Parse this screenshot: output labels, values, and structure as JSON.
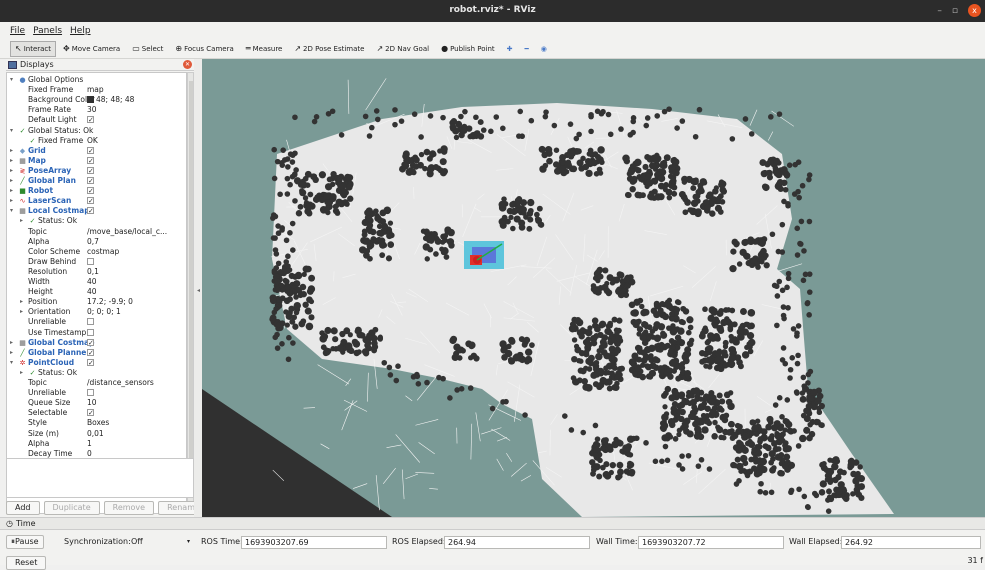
{
  "window": {
    "title": "robot.rviz* - RViz",
    "minimize": "–",
    "maximize": "▫",
    "close": "x"
  },
  "menu": [
    "File",
    "Panels",
    "Help"
  ],
  "toolbar": {
    "tools": [
      {
        "label": "Interact",
        "icon": "cursor-icon",
        "glyph": "↖",
        "active": true
      },
      {
        "label": "Move Camera",
        "icon": "move-camera-icon",
        "glyph": "✥",
        "active": false
      },
      {
        "label": "Select",
        "icon": "select-icon",
        "glyph": "▭",
        "active": false
      },
      {
        "label": "Focus Camera",
        "icon": "focus-camera-icon",
        "glyph": "⊕",
        "active": false
      },
      {
        "label": "Measure",
        "icon": "measure-icon",
        "glyph": "═",
        "active": false
      },
      {
        "label": "2D Pose Estimate",
        "icon": "pose-estimate-icon",
        "glyph": "↗",
        "active": false
      },
      {
        "label": "2D Nav Goal",
        "icon": "nav-goal-icon",
        "glyph": "↗",
        "active": false
      },
      {
        "label": "Publish Point",
        "icon": "publish-point-icon",
        "glyph": "●",
        "active": false
      }
    ],
    "extra": [
      "✚",
      "━",
      "◉"
    ]
  },
  "displays_panel": {
    "title": "Displays",
    "rows": [
      {
        "indent": 0,
        "expand": "▾",
        "icon": "●",
        "icon_color": "#4f7fbf",
        "label": "Global Options",
        "value": "",
        "check": null,
        "blue": false
      },
      {
        "indent": 1,
        "expand": "",
        "icon": "",
        "label": "Fixed Frame",
        "value": "map",
        "check": null
      },
      {
        "indent": 1,
        "expand": "",
        "icon": "",
        "label": "Background Color",
        "value": "48; 48; 48",
        "swatch": "#303030",
        "check": null
      },
      {
        "indent": 1,
        "expand": "",
        "icon": "",
        "label": "Frame Rate",
        "value": "30",
        "check": null
      },
      {
        "indent": 1,
        "expand": "",
        "icon": "",
        "label": "Default Light",
        "value": "",
        "check": true
      },
      {
        "indent": 0,
        "expand": "▾",
        "icon": "✓",
        "icon_color": "#2e8b2e",
        "label": "Global Status: Ok",
        "value": "",
        "check": null
      },
      {
        "indent": 1,
        "expand": "",
        "icon": "✓",
        "icon_color": "#2e8b2e",
        "label": "Fixed Frame",
        "value": "OK",
        "check": null
      },
      {
        "indent": 0,
        "expand": "▸",
        "icon": "◆",
        "icon_color": "#7aa0c8",
        "label": "Grid",
        "value": "",
        "check": true,
        "blue": true
      },
      {
        "indent": 0,
        "expand": "▸",
        "icon": "▦",
        "icon_color": "#666",
        "label": "Map",
        "value": "",
        "check": true,
        "blue": true
      },
      {
        "indent": 0,
        "expand": "▸",
        "icon": "≷",
        "icon_color": "#d03030",
        "label": "PoseArray",
        "value": "",
        "check": true,
        "blue": true
      },
      {
        "indent": 0,
        "expand": "▸",
        "icon": "╱",
        "icon_color": "#2e8b2e",
        "label": "Global Plan",
        "value": "",
        "check": true,
        "blue": true
      },
      {
        "indent": 0,
        "expand": "▸",
        "icon": "■",
        "icon_color": "#2e8b2e",
        "label": "Robot",
        "value": "",
        "check": true,
        "blue": true
      },
      {
        "indent": 0,
        "expand": "▸",
        "icon": "∿",
        "icon_color": "#d03030",
        "label": "LaserScan",
        "value": "",
        "check": true,
        "blue": true
      },
      {
        "indent": 0,
        "expand": "▾",
        "icon": "▦",
        "icon_color": "#666",
        "label": "Local Costmap",
        "value": "",
        "check": true,
        "blue": true
      },
      {
        "indent": 1,
        "expand": "▸",
        "icon": "✓",
        "icon_color": "#2e8b2e",
        "label": "Status: Ok",
        "value": "",
        "check": null
      },
      {
        "indent": 1,
        "expand": "",
        "icon": "",
        "label": "Topic",
        "value": "/move_base/local_c...",
        "check": null
      },
      {
        "indent": 1,
        "expand": "",
        "icon": "",
        "label": "Alpha",
        "value": "0,7",
        "check": null
      },
      {
        "indent": 1,
        "expand": "",
        "icon": "",
        "label": "Color Scheme",
        "value": "costmap",
        "check": null
      },
      {
        "indent": 1,
        "expand": "",
        "icon": "",
        "label": "Draw Behind",
        "value": "",
        "check": false
      },
      {
        "indent": 1,
        "expand": "",
        "icon": "",
        "label": "Resolution",
        "value": "0,1",
        "check": null
      },
      {
        "indent": 1,
        "expand": "",
        "icon": "",
        "label": "Width",
        "value": "40",
        "check": null
      },
      {
        "indent": 1,
        "expand": "",
        "icon": "",
        "label": "Height",
        "value": "40",
        "check": null
      },
      {
        "indent": 1,
        "expand": "▸",
        "icon": "",
        "label": "Position",
        "value": "17.2; -9.9; 0",
        "check": null
      },
      {
        "indent": 1,
        "expand": "▸",
        "icon": "",
        "label": "Orientation",
        "value": "0; 0; 0; 1",
        "check": null
      },
      {
        "indent": 1,
        "expand": "",
        "icon": "",
        "label": "Unreliable",
        "value": "",
        "check": false
      },
      {
        "indent": 1,
        "expand": "",
        "icon": "",
        "label": "Use Timestamp",
        "value": "",
        "check": false
      },
      {
        "indent": 0,
        "expand": "▸",
        "icon": "▦",
        "icon_color": "#666",
        "label": "Global Costmap",
        "value": "",
        "check": true,
        "blue": true
      },
      {
        "indent": 0,
        "expand": "▸",
        "icon": "╱",
        "icon_color": "#2e8b2e",
        "label": "Global Planner",
        "value": "",
        "check": true,
        "blue": true
      },
      {
        "indent": 0,
        "expand": "▾",
        "icon": "✲",
        "icon_color": "#d03030",
        "label": "PointCloud",
        "value": "",
        "check": true,
        "blue": true
      },
      {
        "indent": 1,
        "expand": "▸",
        "icon": "✓",
        "icon_color": "#2e8b2e",
        "label": "Status: Ok",
        "value": "",
        "check": null
      },
      {
        "indent": 1,
        "expand": "",
        "icon": "",
        "label": "Topic",
        "value": "/distance_sensors",
        "check": null
      },
      {
        "indent": 1,
        "expand": "",
        "icon": "",
        "label": "Unreliable",
        "value": "",
        "check": false
      },
      {
        "indent": 1,
        "expand": "",
        "icon": "",
        "label": "Queue Size",
        "value": "10",
        "check": null
      },
      {
        "indent": 1,
        "expand": "",
        "icon": "",
        "label": "Selectable",
        "value": "",
        "check": true
      },
      {
        "indent": 1,
        "expand": "",
        "icon": "",
        "label": "Style",
        "value": "Boxes",
        "check": null
      },
      {
        "indent": 1,
        "expand": "",
        "icon": "",
        "label": "Size (m)",
        "value": "0,01",
        "check": null
      },
      {
        "indent": 1,
        "expand": "",
        "icon": "",
        "label": "Alpha",
        "value": "1",
        "check": null
      },
      {
        "indent": 1,
        "expand": "",
        "icon": "",
        "label": "Decay Time",
        "value": "0",
        "check": null
      }
    ],
    "buttons": {
      "add": "Add",
      "duplicate": "Duplicate",
      "remove": "Remove",
      "rename": "Rename"
    }
  },
  "time_panel": {
    "title": "Time",
    "pause_label": "Pause",
    "sync_label": "Synchronization:",
    "sync_value": "Off",
    "ros_time_label": "ROS Time:",
    "ros_time": "1693903207.69",
    "ros_elapsed_label": "ROS Elapsed:",
    "ros_elapsed": "264.94",
    "wall_time_label": "Wall Time:",
    "wall_time": "1693903207.72",
    "wall_elapsed_label": "Wall Elapsed:",
    "wall_elapsed": "264.92",
    "reset_label": "Reset",
    "fps": "31 f"
  }
}
